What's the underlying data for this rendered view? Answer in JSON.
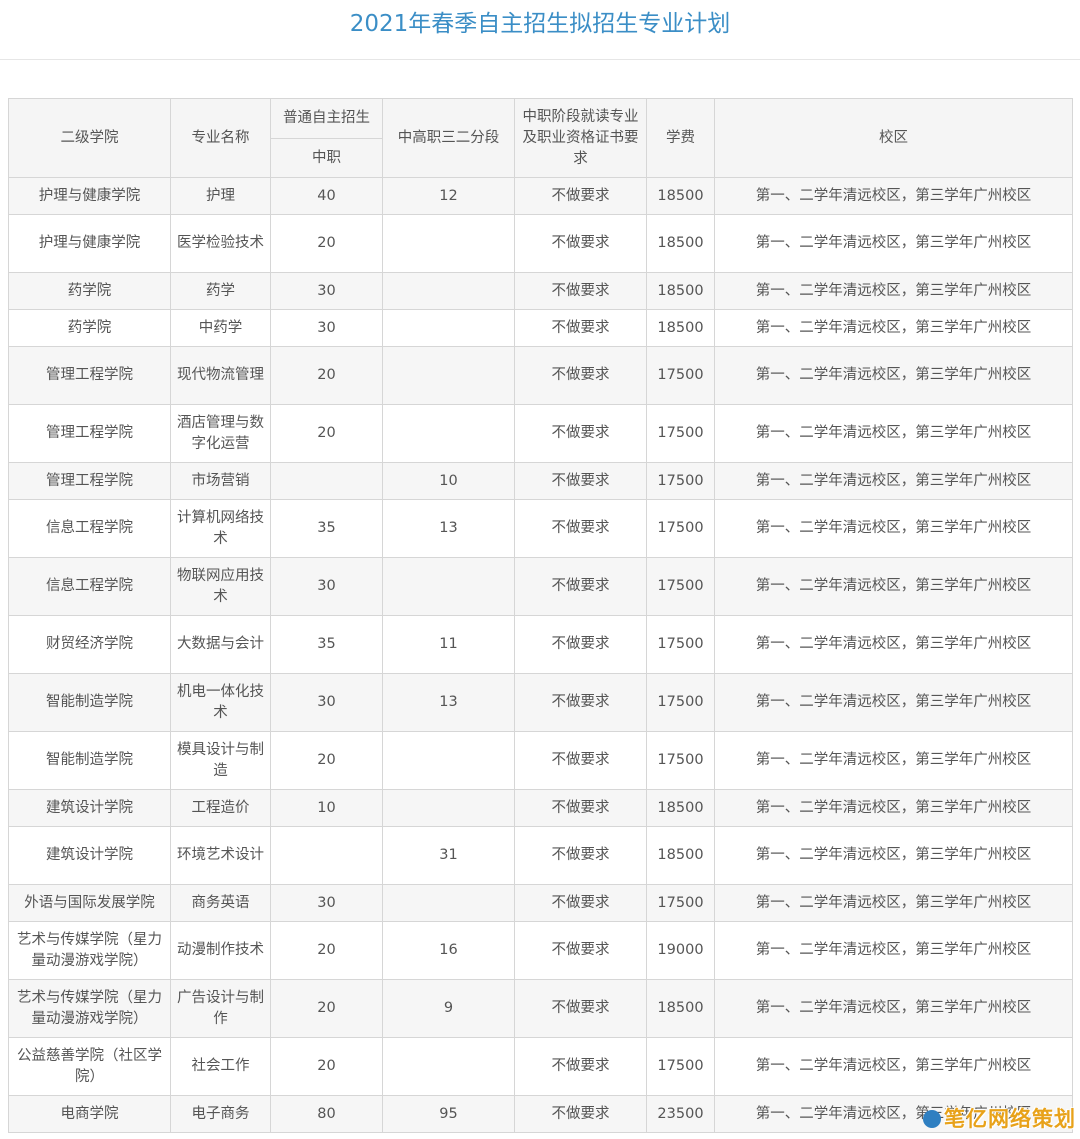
{
  "page": {
    "title": "2021年春季自主招生拟招生专业计划"
  },
  "table": {
    "headers": {
      "college": "二级学院",
      "major": "专业名称",
      "regular_group": "普通自主招生",
      "regular_sub": "中职",
      "three_two": "中高职三二分段",
      "requirement": "中职阶段就读专业及职业资格证书要求",
      "fee": "学费",
      "campus": "校区"
    },
    "rows": [
      {
        "college": "护理与健康学院",
        "major": "护理",
        "regular": "40",
        "three_two": "12",
        "requirement": "不做要求",
        "fee": "18500",
        "campus": "第一、二学年清远校区，第三学年广州校区"
      },
      {
        "college": "护理与健康学院",
        "major": "医学检验技术",
        "regular": "20",
        "three_two": "",
        "requirement": "不做要求",
        "fee": "18500",
        "campus": "第一、二学年清远校区，第三学年广州校区"
      },
      {
        "college": "药学院",
        "major": "药学",
        "regular": "30",
        "three_two": "",
        "requirement": "不做要求",
        "fee": "18500",
        "campus": "第一、二学年清远校区，第三学年广州校区"
      },
      {
        "college": "药学院",
        "major": "中药学",
        "regular": "30",
        "three_two": "",
        "requirement": "不做要求",
        "fee": "18500",
        "campus": "第一、二学年清远校区，第三学年广州校区"
      },
      {
        "college": "管理工程学院",
        "major": "现代物流管理",
        "regular": "20",
        "three_two": "",
        "requirement": "不做要求",
        "fee": "17500",
        "campus": "第一、二学年清远校区，第三学年广州校区"
      },
      {
        "college": "管理工程学院",
        "major": "酒店管理与数字化运营",
        "regular": "20",
        "three_two": "",
        "requirement": "不做要求",
        "fee": "17500",
        "campus": "第一、二学年清远校区，第三学年广州校区"
      },
      {
        "college": "管理工程学院",
        "major": "市场营销",
        "regular": "",
        "three_two": "10",
        "requirement": "不做要求",
        "fee": "17500",
        "campus": "第一、二学年清远校区，第三学年广州校区"
      },
      {
        "college": "信息工程学院",
        "major": "计算机网络技术",
        "regular": "35",
        "three_two": "13",
        "requirement": "不做要求",
        "fee": "17500",
        "campus": "第一、二学年清远校区，第三学年广州校区"
      },
      {
        "college": "信息工程学院",
        "major": "物联网应用技术",
        "regular": "30",
        "three_two": "",
        "requirement": "不做要求",
        "fee": "17500",
        "campus": "第一、二学年清远校区，第三学年广州校区"
      },
      {
        "college": "财贸经济学院",
        "major": "大数据与会计",
        "regular": "35",
        "three_two": "11",
        "requirement": "不做要求",
        "fee": "17500",
        "campus": "第一、二学年清远校区，第三学年广州校区"
      },
      {
        "college": "智能制造学院",
        "major": "机电一体化技术",
        "regular": "30",
        "three_two": "13",
        "requirement": "不做要求",
        "fee": "17500",
        "campus": "第一、二学年清远校区，第三学年广州校区"
      },
      {
        "college": "智能制造学院",
        "major": "模具设计与制造",
        "regular": "20",
        "three_two": "",
        "requirement": "不做要求",
        "fee": "17500",
        "campus": "第一、二学年清远校区，第三学年广州校区"
      },
      {
        "college": "建筑设计学院",
        "major": "工程造价",
        "regular": "10",
        "three_two": "",
        "requirement": "不做要求",
        "fee": "18500",
        "campus": "第一、二学年清远校区，第三学年广州校区"
      },
      {
        "college": "建筑设计学院",
        "major": "环境艺术设计",
        "regular": "",
        "three_two": "31",
        "requirement": "不做要求",
        "fee": "18500",
        "campus": "第一、二学年清远校区，第三学年广州校区"
      },
      {
        "college": "外语与国际发展学院",
        "major": "商务英语",
        "regular": "30",
        "three_two": "",
        "requirement": "不做要求",
        "fee": "17500",
        "campus": "第一、二学年清远校区，第三学年广州校区"
      },
      {
        "college": "艺术与传媒学院（星力量动漫游戏学院）",
        "major": "动漫制作技术",
        "regular": "20",
        "three_two": "16",
        "requirement": "不做要求",
        "fee": "19000",
        "campus": "第一、二学年清远校区，第三学年广州校区"
      },
      {
        "college": "艺术与传媒学院（星力量动漫游戏学院）",
        "major": "广告设计与制作",
        "regular": "20",
        "three_two": "9",
        "requirement": "不做要求",
        "fee": "18500",
        "campus": "第一、二学年清远校区，第三学年广州校区"
      },
      {
        "college": "公益慈善学院（社区学院）",
        "major": "社会工作",
        "regular": "20",
        "three_two": "",
        "requirement": "不做要求",
        "fee": "17500",
        "campus": "第一、二学年清远校区，第三学年广州校区"
      },
      {
        "college": "电商学院",
        "major": "电子商务",
        "regular": "80",
        "three_two": "95",
        "requirement": "不做要求",
        "fee": "23500",
        "campus": "第一、二学年清远校区，第三学年广州校区"
      }
    ]
  },
  "watermark": {
    "text": "笔亿网络策划",
    "icon": "logo-circle-icon",
    "color": "#e8a21a"
  }
}
